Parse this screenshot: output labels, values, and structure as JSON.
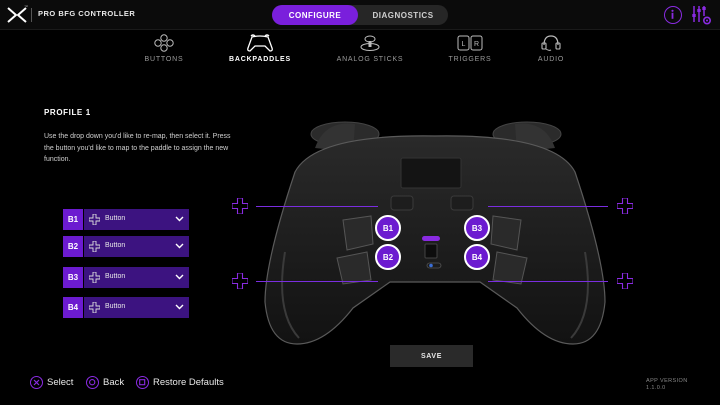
{
  "header": {
    "trademark": "™",
    "app_title": "PRO BFG CONTROLLER",
    "modes": [
      "CONFIGURE",
      "DIAGNOSTICS"
    ],
    "active_mode": "CONFIGURE"
  },
  "tabs": [
    {
      "label": "BUTTONS",
      "icon": "buttons-icon"
    },
    {
      "label": "BACKPADDLES",
      "icon": "backpaddles-icon",
      "active": true
    },
    {
      "label": "ANALOG STICKS",
      "icon": "analog-stick-icon"
    },
    {
      "label": "TRIGGERS",
      "icon": "triggers-icon"
    },
    {
      "label": "AUDIO",
      "icon": "headset-icon"
    }
  ],
  "profile": {
    "title": "PROFILE 1",
    "instructions": "Use the drop down you'd like to re-map, then select it. Press the button you'd like to map to the paddle to assign the new function."
  },
  "mappings": [
    {
      "paddle": "B1",
      "value": "Button"
    },
    {
      "paddle": "B2",
      "value": "Button"
    },
    {
      "paddle": "B3",
      "value": "Button"
    },
    {
      "paddle": "B4",
      "value": "Button"
    }
  ],
  "save_label": "SAVE",
  "footer": {
    "hints": [
      {
        "icon": "cross-button-icon",
        "label": "Select"
      },
      {
        "icon": "circle-button-icon",
        "label": "Back"
      },
      {
        "icon": "square-button-icon",
        "label": "Restore Defaults"
      }
    ],
    "version_label": "APP VERSION",
    "version": "1.1.0.0"
  },
  "colors": {
    "accent": "#7a1fdc",
    "accent_dark": "#3c1380",
    "background": "#000000"
  }
}
